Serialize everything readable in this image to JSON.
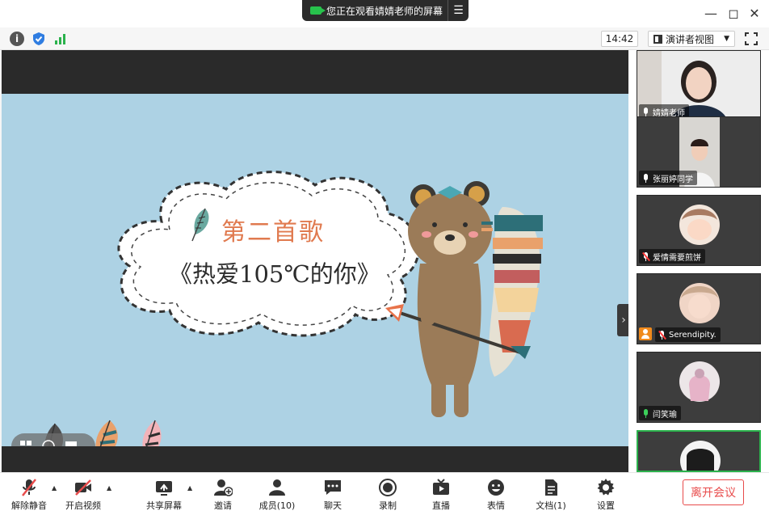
{
  "titlebar": {
    "share_banner": "您正在观看婧婧老师的屏幕",
    "share_menu_icon": "list-menu-icon",
    "controls": [
      "minimize-icon",
      "maximize-icon",
      "close-icon"
    ]
  },
  "infobar": {
    "time": "14:42",
    "view_mode": "演讲者视图"
  },
  "slide": {
    "title": "第二首歌",
    "subtitle": "《热爱105℃的你》"
  },
  "participants": [
    {
      "name": "婧婧老师",
      "mic": "on"
    },
    {
      "name": "张丽婷同学",
      "mic": "on"
    },
    {
      "name": "爱情需要煎饼",
      "mic": "muted"
    },
    {
      "name": "Serendipity.",
      "mic": "muted",
      "host": true
    },
    {
      "name": "闫笑瑜",
      "mic": "speaking"
    },
    {
      "name": "",
      "mic": "none"
    }
  ],
  "toolbar": {
    "unmute": "解除静音",
    "start_video": "开启视频",
    "share_screen": "共享屏幕",
    "invite": "邀请",
    "members": "成员(10)",
    "chat": "聊天",
    "record": "录制",
    "live": "直播",
    "emoji": "表情",
    "docs": "文档(1)",
    "settings": "设置",
    "leave": "离开会议"
  },
  "colors": {
    "slide_bg": "#add2e4",
    "title_color": "#e07a4f",
    "accent_green": "#2bb24c",
    "leave_red": "#e84b4b"
  }
}
